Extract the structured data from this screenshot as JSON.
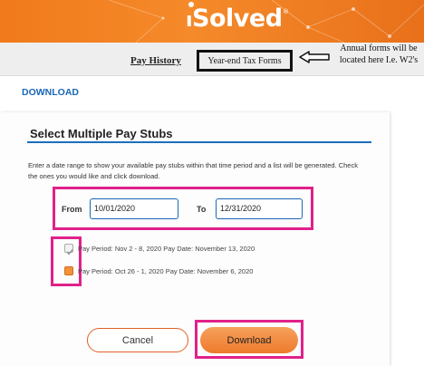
{
  "brand": {
    "logo_text": "Solved",
    "logo_mark": "®",
    "color": "#f07a1c"
  },
  "nav": {
    "tabs": [
      {
        "label": "Pay History"
      },
      {
        "label": "Year-end Tax Forms"
      }
    ]
  },
  "annotation": {
    "text": "Annual forms will be located here I.e. W2's"
  },
  "download_link": "DOWNLOAD",
  "panel": {
    "title": "Select Multiple Pay Stubs",
    "instructions": "Enter a date range to show your available pay stubs within that time period and a list will be generated. Check the ones you would like and click download.",
    "from_label": "From",
    "from_value": "10/01/2020",
    "to_label": "To",
    "to_value": "12/31/2020",
    "pay_periods": [
      {
        "text": "Pay Period: Nov 2 - 8, 2020 Pay Date: November 13, 2020",
        "checked": true
      },
      {
        "text": "Pay Period: Oct 26 - 1, 2020 Pay Date: November 6, 2020",
        "checked": false
      }
    ],
    "cancel_label": "Cancel",
    "download_label": "Download"
  },
  "colors": {
    "highlight": "#e0218a",
    "link": "#1a66b5",
    "accent": "#ee7a2c"
  }
}
